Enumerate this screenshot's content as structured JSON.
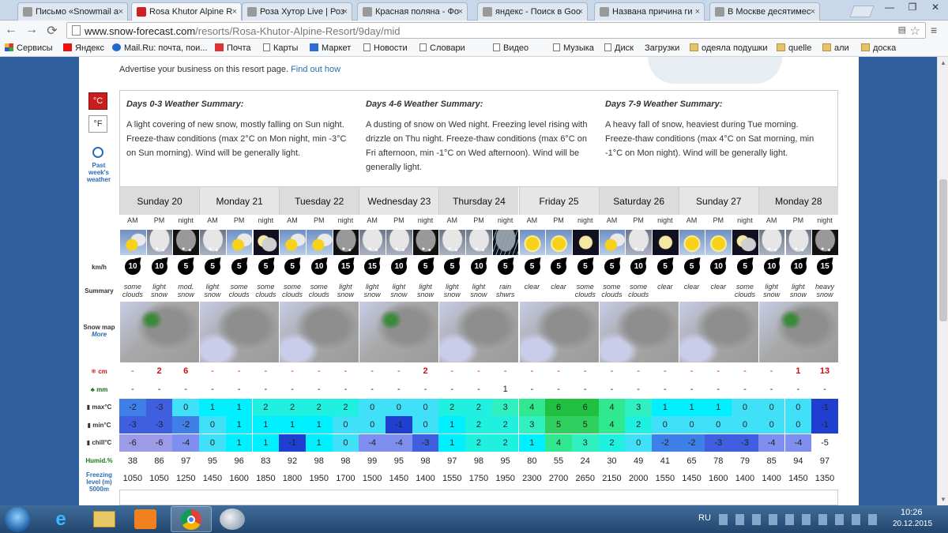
{
  "browser": {
    "tabs": [
      {
        "title": "Письмо «Snowmail a",
        "active": false,
        "icon": "mail-icon"
      },
      {
        "title": "Rosa Khutor Alpine R",
        "active": true,
        "icon": "snow-forecast-icon"
      },
      {
        "title": "Роза Хутор Live | Роз",
        "active": false,
        "icon": "rosa-live-icon"
      },
      {
        "title": "Красная поляна - Фо",
        "active": false,
        "icon": "photo-icon"
      },
      {
        "title": "яндекс - Поиск в Goo",
        "active": false,
        "icon": "google-icon"
      },
      {
        "title": "Названа причина ги",
        "active": false,
        "icon": "news-icon"
      },
      {
        "title": "В Москве десятимес",
        "active": false,
        "icon": "rg-icon"
      }
    ],
    "url_host": "www.snow-forecast.com",
    "url_path": "/resorts/Rosa-Khutor-Alpine-Resort/9day/mid",
    "bookmarks": [
      {
        "label": "Сервисы",
        "icon": "apps"
      },
      {
        "label": "Яндекс",
        "icon": "ya"
      },
      {
        "label": "Mail.Ru: почта, пои...",
        "icon": "mail"
      },
      {
        "label": "Почта",
        "icon": "gmail"
      },
      {
        "label": "Карты",
        "icon": "page"
      },
      {
        "label": "Маркет",
        "icon": "market"
      },
      {
        "label": "Новости",
        "icon": "page"
      },
      {
        "label": "Словари",
        "icon": "page"
      },
      {
        "label": "Видео",
        "icon": "page"
      },
      {
        "label": "Музыка",
        "icon": "page"
      },
      {
        "label": "Диск",
        "icon": "page"
      },
      {
        "label": "Загрузки",
        "icon": "download"
      },
      {
        "label": "одеяла подушки",
        "icon": "folder"
      },
      {
        "label": "quelle",
        "icon": "folder"
      },
      {
        "label": "али",
        "icon": "folder"
      },
      {
        "label": "доска",
        "icon": "folder"
      }
    ]
  },
  "page": {
    "advert_text": "Advertise your business on this resort page.",
    "advert_link": "Find out how",
    "unit_c": "°C",
    "unit_f": "°F",
    "past_week": "Past week's weather",
    "summaries": [
      {
        "title": "Days 0-3 Weather Summary:",
        "text": "A light covering of new snow, mostly falling on Sun night. Freeze-thaw conditions (max 2°C on Mon night, min -3°C on Sun morning). Wind will be generally light."
      },
      {
        "title": "Days 4-6 Weather Summary:",
        "text": "A dusting of snow on Wed night. Freezing level rising with drizzle on Thu night. Freeze-thaw conditions (max 6°C on Fri afternoon, min -1°C on Wed afternoon). Wind will be generally light."
      },
      {
        "title": "Days 7-9 Weather Summary:",
        "text": "A heavy fall of snow, heaviest during Tue morning. Freeze-thaw conditions (max 4°C on Sat morning, min -1°C on Mon night). Wind will be generally light."
      }
    ],
    "row_labels": {
      "kmh": "km/h",
      "summary": "Summary",
      "snowmap": "Snow map",
      "more": "More",
      "snow": "cm",
      "rain": "mm",
      "max": "max°C",
      "min": "min°C",
      "chill": "chill°C",
      "humid": "Humid.%",
      "freezing": "Freezing level (m)",
      "elev": "5000m"
    },
    "periods": [
      "AM",
      "PM",
      "night"
    ],
    "days": [
      "Sunday 20",
      "Monday 21",
      "Tuesday 22",
      "Wednesday 23",
      "Thursday 24",
      "Friday 25",
      "Saturday 26",
      "Sunday 27",
      "Monday 28"
    ],
    "weather_icons": [
      "suncloud",
      "cloudsnow",
      "nightsnow",
      "cloudsnow",
      "suncloud",
      "mooncloud",
      "suncloud",
      "suncloud",
      "nightsnow",
      "cloudsnow",
      "cloudsnow",
      "nightsnow",
      "cloudsnow",
      "cloudsnow",
      "rain",
      "sun",
      "sun",
      "moon",
      "suncloud",
      "cloudsnow",
      "moon",
      "sun",
      "sun",
      "mooncloud",
      "cloudsnow",
      "cloudsnow",
      "nightsnow"
    ],
    "wind": [
      "10",
      "10",
      "5",
      "5",
      "5",
      "5",
      "5",
      "10",
      "15",
      "15",
      "10",
      "5",
      "5",
      "10",
      "5",
      "5",
      "5",
      "5",
      "5",
      "10",
      "5",
      "5",
      "10",
      "5",
      "10",
      "10",
      "15"
    ],
    "summary_text": [
      "some clouds",
      "light snow",
      "mod. snow",
      "light snow",
      "some clouds",
      "some clouds",
      "some clouds",
      "some clouds",
      "light snow",
      "light snow",
      "light snow",
      "light snow",
      "light snow",
      "light snow",
      "rain shwrs",
      "clear",
      "clear",
      "some clouds",
      "some clouds",
      "some clouds",
      "clear",
      "clear",
      "clear",
      "some clouds",
      "light snow",
      "light snow",
      "heavy snow"
    ],
    "snow_cm": [
      "-",
      "2",
      "6",
      "-",
      "-",
      "-",
      "-",
      "-",
      "-",
      "-",
      "-",
      "2",
      "-",
      "-",
      "-",
      "-",
      "-",
      "-",
      "-",
      "-",
      "-",
      "-",
      "-",
      "-",
      "-",
      "1",
      "13"
    ],
    "rain_mm": [
      "-",
      "-",
      "-",
      "-",
      "-",
      "-",
      "-",
      "-",
      "-",
      "-",
      "-",
      "-",
      "-",
      "-",
      "1",
      "-",
      "-",
      "-",
      "-",
      "-",
      "-",
      "-",
      "-",
      "-",
      "-",
      "-",
      "-"
    ],
    "max_c": [
      "-2",
      "-3",
      "0",
      "1",
      "1",
      "2",
      "2",
      "2",
      "2",
      "0",
      "0",
      "0",
      "2",
      "2",
      "3",
      "4",
      "6",
      "6",
      "4",
      "3",
      "1",
      "1",
      "1",
      "0",
      "0",
      "0",
      "-1"
    ],
    "min_c": [
      "-3",
      "-3",
      "-2",
      "0",
      "1",
      "1",
      "1",
      "1",
      "0",
      "0",
      "-1",
      "0",
      "1",
      "2",
      "2",
      "3",
      "5",
      "5",
      "4",
      "2",
      "0",
      "0",
      "0",
      "0",
      "0",
      "0",
      "-1"
    ],
    "chill_c": [
      "-6",
      "-6",
      "-4",
      "0",
      "1",
      "1",
      "-1",
      "1",
      "0",
      "-4",
      "-4",
      "-3",
      "1",
      "2",
      "2",
      "1",
      "4",
      "3",
      "2",
      "0",
      "-2",
      "-2",
      "-3",
      "-3",
      "-4",
      "-4",
      "-5"
    ],
    "humidity": [
      "38",
      "86",
      "97",
      "95",
      "96",
      "83",
      "92",
      "98",
      "98",
      "99",
      "95",
      "98",
      "97",
      "98",
      "95",
      "80",
      "55",
      "24",
      "30",
      "49",
      "41",
      "65",
      "78",
      "79",
      "85",
      "94",
      "97"
    ],
    "freezing": [
      "1050",
      "1050",
      "1250",
      "1450",
      "1600",
      "1850",
      "1800",
      "1950",
      "1700",
      "1500",
      "1450",
      "1400",
      "1550",
      "1750",
      "1950",
      "2300",
      "2700",
      "2650",
      "2150",
      "2000",
      "1550",
      "1450",
      "1600",
      "1400",
      "1400",
      "1450",
      "1350"
    ]
  },
  "taskbar": {
    "lang": "RU",
    "time": "10:26",
    "date": "20.12.2015"
  },
  "colors": {
    "temp_scale": {
      "-6": "#9b9be8",
      "-4": "#7f8ff0",
      "-3": "#3f5fe0",
      "-2": "#3f7fe8",
      "-1": "#1f3fd0",
      "0": "#40e0f8",
      "1": "#00f0ff",
      "2": "#20f0e0",
      "3": "#30f0c0",
      "4": "#30e890",
      "5": "#30d060",
      "6": "#20c040"
    }
  }
}
